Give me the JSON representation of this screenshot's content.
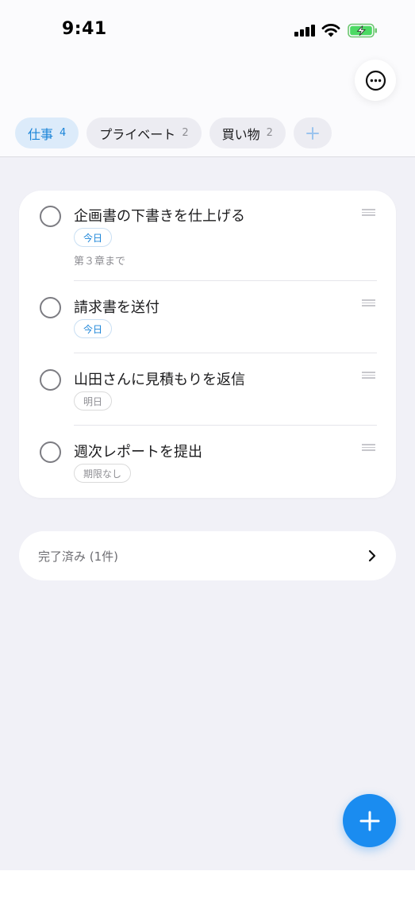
{
  "status_bar": {
    "time": "9:41"
  },
  "header": {
    "more_icon": "ellipsis-circle-icon"
  },
  "tabs": [
    {
      "label": "仕事",
      "count": "4",
      "active": true
    },
    {
      "label": "プライベート",
      "count": "2",
      "active": false
    },
    {
      "label": "買い物",
      "count": "2",
      "active": false
    }
  ],
  "tab_add_icon": "plus-icon",
  "tasks": [
    {
      "title": "企画書の下書きを仕上げる",
      "due": "今日",
      "note": "第３章まで"
    },
    {
      "title": "請求書を送付",
      "due": "今日"
    },
    {
      "title": "山田さんに見積もりを返信",
      "due": "明日"
    },
    {
      "title": "週次レポートを提出",
      "due": "期限なし"
    }
  ],
  "completed": {
    "label": "完了済み (1件)"
  },
  "fab_icon": "plus-icon",
  "colors": {
    "accent": "#1a8cf0",
    "background": "#f1f1f7"
  }
}
